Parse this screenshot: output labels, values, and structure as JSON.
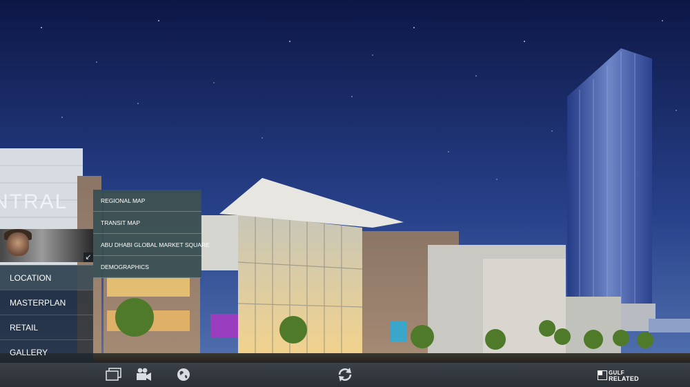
{
  "menu": {
    "items": [
      {
        "label": "LOCATION"
      },
      {
        "label": "MASTERPLAN"
      },
      {
        "label": "RETAIL"
      },
      {
        "label": "GALLERY"
      }
    ],
    "active": "LOCATION"
  },
  "submenu": {
    "items": [
      {
        "label": "REGIONAL MAP"
      },
      {
        "label": "TRANSIT MAP"
      },
      {
        "label": "ABU DHABI GLOBAL MARKET SQUARE"
      },
      {
        "label": "DEMOGRAPHICS"
      }
    ]
  },
  "building_sign": "NTRAL",
  "toolbar": {
    "icons": [
      "photos-icon",
      "video-camera-icon",
      "globe-icon",
      "refresh-icon"
    ]
  },
  "logo": {
    "line1": "GULF",
    "line2": "RELATED"
  },
  "colors": {
    "sky_top": "#0d1746",
    "sky_bottom": "#3c5f9c",
    "submenu_bg": "#385054",
    "bar_bg": "#2e3339"
  }
}
